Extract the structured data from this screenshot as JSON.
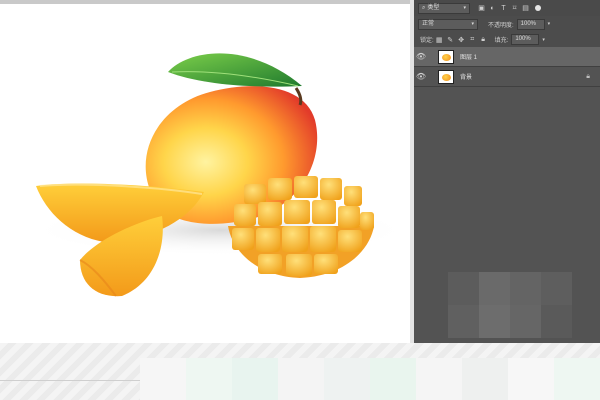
{
  "layers_panel": {
    "filter": {
      "kind_label": "类型",
      "icons": [
        "image-filter-icon",
        "adjustment-filter-icon",
        "type-filter-icon",
        "shape-filter-icon",
        "smartobject-filter-icon"
      ]
    },
    "blend": {
      "mode": "正常",
      "opacity_label": "不透明度:",
      "opacity_value": "100%"
    },
    "lock_row": {
      "lock_label": "锁定:",
      "fill_label": "填充:",
      "fill_value": "100%"
    },
    "layers": [
      {
        "name": "图层 1",
        "visible": true,
        "selected": true
      },
      {
        "name": "背景",
        "visible": true,
        "selected": false,
        "locked": true
      }
    ]
  },
  "colors": {
    "panel_bg": "#535353",
    "selected_layer": "#666666",
    "canvas_bg": "#ffffff"
  }
}
